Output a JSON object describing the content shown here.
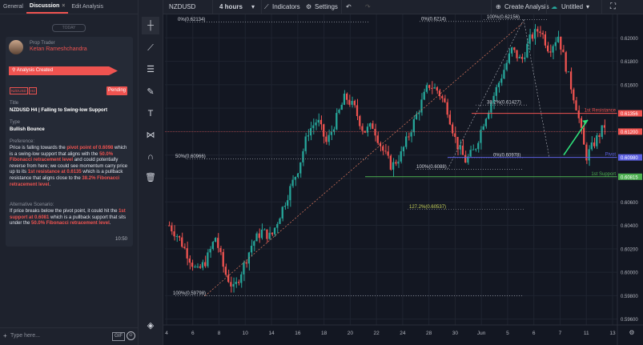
{
  "tabs": {
    "general": "General",
    "discussion": "Discussion",
    "close": "×",
    "edit": "Edit Analysis"
  },
  "today": "TODAY",
  "author": {
    "role": "Prop Trader",
    "name": "Ketan Rameshchandra"
  },
  "status_banner": "Analysis Created",
  "tags": [
    "NZDUSD",
    "H4"
  ],
  "pending": "Pending",
  "title_label": "Title",
  "title": "NZDUSD H4 | Falling to Swing-low Support",
  "type_label": "Type",
  "type": "Bullish Bounce",
  "preference_label": "Preference:",
  "preference": [
    "Price is falling towards the ",
    "pivot point of 0.6098",
    " which is a swing-low support that aligns with the ",
    "50.0% Fibonacci retracement level",
    " and could potentially reverse from here; we could see momentum carry price up to its ",
    "1st resistance at 0.6135",
    " which is a pullback resistance that aligns close to the ",
    "38.2% Fibonacci retracement level",
    "."
  ],
  "alternative_label": "Alternative Scenario:",
  "alternative": [
    "If price breaks below the pivot point, it could hit the ",
    "1st support at 0.6081",
    " which is a pullback support that sits under the ",
    "50.0% Fibonacci retracement level",
    "."
  ],
  "time": "10:50",
  "message_placeholder": "Type here...",
  "gif": "GIF",
  "topbar": {
    "symbol": "NZDUSD",
    "interval": "4 hours",
    "indicators": "Indicators",
    "settings": "Settings",
    "create": "Create Analysis",
    "untitled": "Untitled"
  },
  "colors": {
    "accent": "#ef5350",
    "up": "#26a69a",
    "down": "#ef5350",
    "pivot": "#5b5fe0",
    "support": "#4caf50"
  },
  "chart_data": {
    "type": "candlestick",
    "symbol": "NZDUSD",
    "timeframe": "4 hours",
    "y_ticks": [
      "0.62000",
      "0.61800",
      "0.61600",
      "0.61400",
      "0.61200",
      "0.61000",
      "0.60800",
      "0.60600",
      "0.60400",
      "0.60200",
      "0.60000",
      "0.59800",
      "0.59600"
    ],
    "ylim": [
      0.5955,
      0.622
    ],
    "x_ticks": [
      "4",
      "6",
      "8",
      "10",
      "14",
      "16",
      "18",
      "20",
      "22",
      "24",
      "28",
      "30",
      "Jun",
      "5",
      "6",
      "7",
      "11",
      "13"
    ],
    "current_price": "0.61200",
    "levels": [
      {
        "name": "1st Resistance",
        "value": 0.61356,
        "label": "0.61356"
      },
      {
        "name": "Pivot",
        "value": 0.6098,
        "label": "0.60980"
      },
      {
        "name": "1st Support",
        "value": 0.60815,
        "label": "0.60815"
      }
    ],
    "fib_labels": [
      {
        "text": "0%(0.62134)",
        "value": 0.62134
      },
      {
        "text": "50%(0.60966)",
        "value": 0.60966
      },
      {
        "text": "100%(0.59798)",
        "value": 0.59798
      },
      {
        "text": "0%(0.6214)",
        "value": 0.6214
      },
      {
        "text": "100%(0.62156)",
        "value": 0.62156
      },
      {
        "text": "38.2%(0.61427)",
        "value": 0.61427
      },
      {
        "text": "0%(0.60978)",
        "value": 0.60978
      },
      {
        "text": "100%(0.6088)",
        "value": 0.6088
      },
      {
        "text": "127.2%(0.60537)",
        "value": 0.60537
      }
    ],
    "path": [
      0.604,
      0.603,
      0.6015,
      0.6,
      0.601,
      0.603,
      0.6,
      0.5985,
      0.6005,
      0.6025,
      0.6035,
      0.603,
      0.605,
      0.607,
      0.609,
      0.612,
      0.613,
      0.611,
      0.613,
      0.615,
      0.614,
      0.612,
      0.6125,
      0.6105,
      0.609,
      0.61,
      0.612,
      0.614,
      0.616,
      0.6155,
      0.614,
      0.611,
      0.6095,
      0.6105,
      0.613,
      0.615,
      0.617,
      0.619,
      0.618,
      0.62,
      0.6208,
      0.619,
      0.6202,
      0.617,
      0.614,
      0.6098,
      0.6112,
      0.6125
    ]
  }
}
